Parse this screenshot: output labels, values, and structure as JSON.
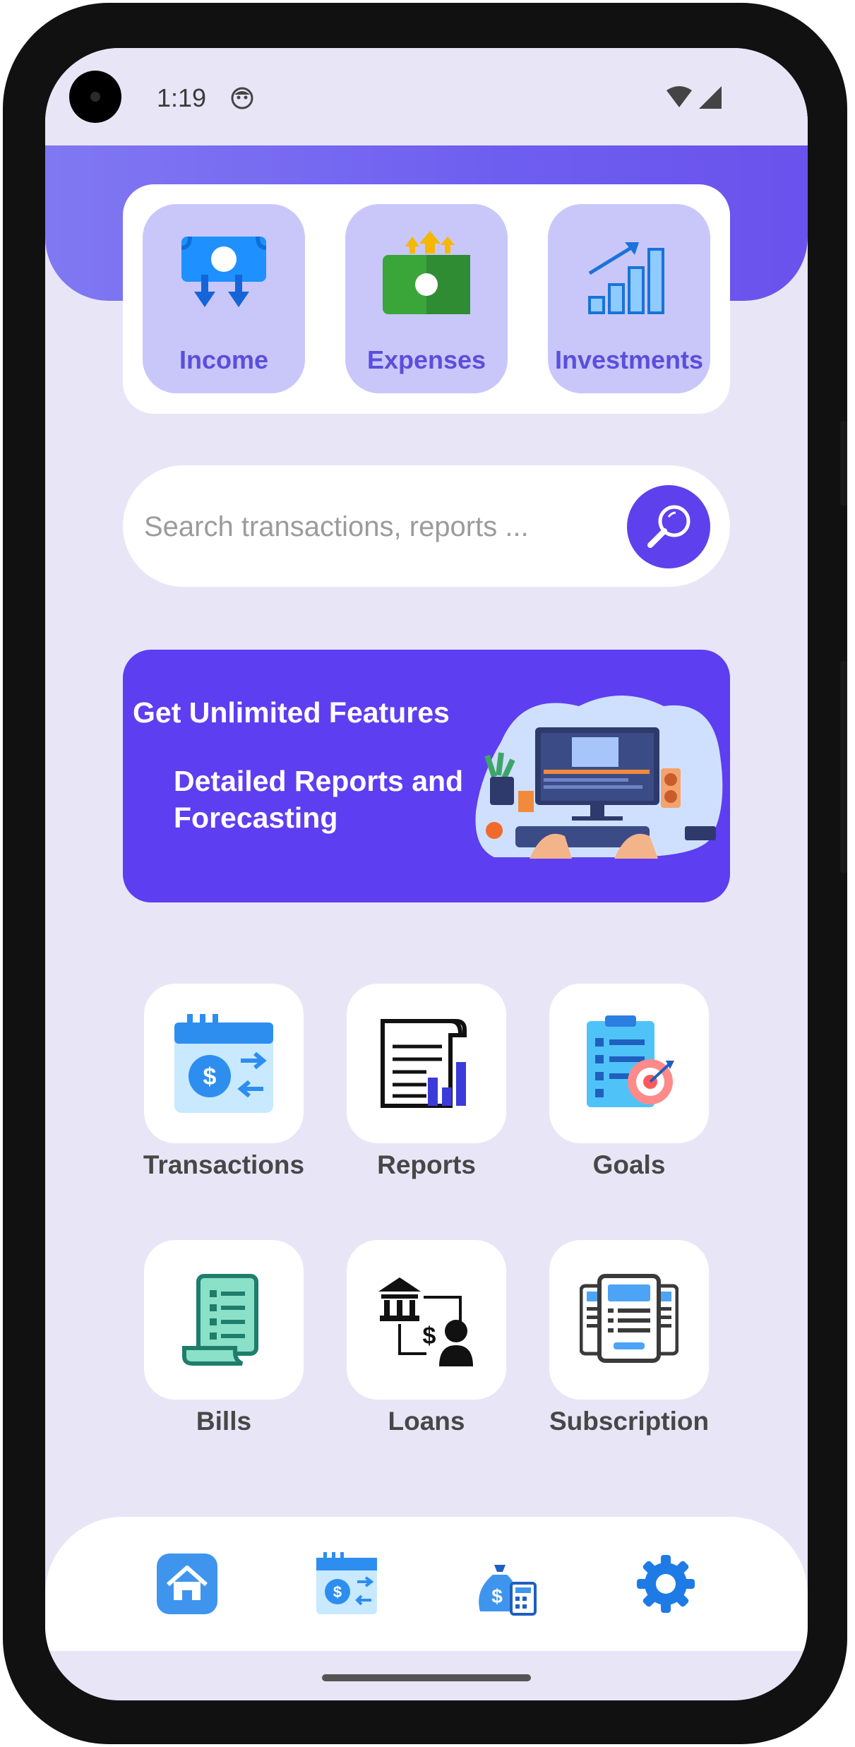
{
  "status_bar": {
    "time": "1:19"
  },
  "quick_actions": [
    {
      "label": "Income",
      "icon": "money-in-icon"
    },
    {
      "label": "Expenses",
      "icon": "money-out-icon"
    },
    {
      "label": "Investments",
      "icon": "growth-chart-icon"
    }
  ],
  "search": {
    "placeholder": "Search transactions, reports ..."
  },
  "promo": {
    "title": "Get Unlimited Features",
    "subtitle": "Detailed Reports and Forecasting"
  },
  "grid": [
    {
      "label": "Transactions",
      "icon": "transactions-calendar-icon"
    },
    {
      "label": "Reports",
      "icon": "report-chart-icon"
    },
    {
      "label": "Goals",
      "icon": "goals-target-icon"
    },
    {
      "label": "Bills",
      "icon": "bill-receipt-icon"
    },
    {
      "label": "Loans",
      "icon": "bank-loan-icon"
    },
    {
      "label": "Subscription",
      "icon": "subscription-cards-icon"
    }
  ],
  "bottom_nav": [
    "home-icon",
    "transactions-icon",
    "budget-icon",
    "settings-icon"
  ],
  "colors": {
    "accent": "#5d3ef0",
    "background": "#e8e6f6",
    "tile_purple": "#c9c7fa",
    "label_purple": "#5a4fdb"
  }
}
